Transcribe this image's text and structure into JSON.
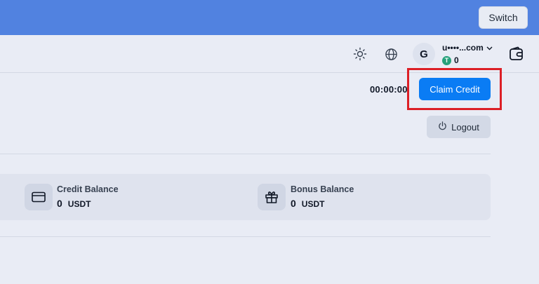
{
  "topbar": {
    "switch_label": "Switch",
    "accent": "#5182e0"
  },
  "header": {
    "icons": [
      "sun-icon",
      "globe-icon",
      "wallet-icon"
    ],
    "avatar_letter": "G",
    "user_name": "u••••...com",
    "user_balance": "0",
    "balance_token": "T"
  },
  "action": {
    "timer": "00:00:00",
    "claim_label": "Claim Credit",
    "logout_label": "Logout",
    "claim_color": "#0a7cf4",
    "highlight_color": "#dc1f26"
  },
  "balances": [
    {
      "title": "Credit Balance",
      "value": "0",
      "currency": "USDT",
      "icon": "credit-card-icon"
    },
    {
      "title": "Bonus Balance",
      "value": "0",
      "currency": "USDT",
      "icon": "gift-icon"
    }
  ]
}
